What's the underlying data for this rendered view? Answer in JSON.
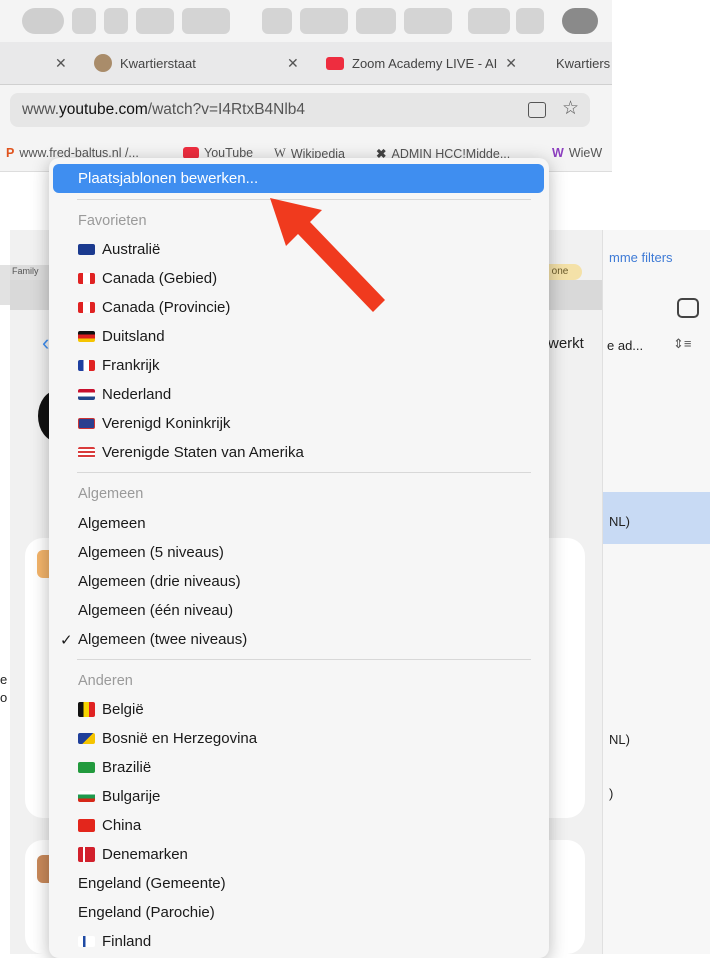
{
  "browser": {
    "tabs": [
      {
        "title": "Kwartierstaat"
      },
      {
        "title": "Zoom Academy LIVE - AI"
      },
      {
        "title": "Kwartiers"
      }
    ],
    "url_prefix": "www.",
    "url_domain": "youtube.com",
    "url_path": "/watch?v=I4RtxB4Nlb4",
    "bookmarks": [
      "www.fred-baltus.nl /...",
      "YouTube",
      "Wikipedia",
      "ADMIN HCC!Midde...",
      "WieW"
    ]
  },
  "background": {
    "right_labels": [
      "mme filters",
      "e ad...",
      "werkt",
      "NL)",
      "NL)",
      ")",
      "Family",
      "one",
      "e",
      "o"
    ]
  },
  "menu": {
    "edit_label": "Plaatsjablonen bewerken...",
    "favorites_header": "Favorieten",
    "favorites": [
      {
        "label": "Australië",
        "flag": "australia"
      },
      {
        "label": "Canada (Gebied)",
        "flag": "canada"
      },
      {
        "label": "Canada (Provincie)",
        "flag": "canada"
      },
      {
        "label": "Duitsland",
        "flag": "germany"
      },
      {
        "label": "Frankrijk",
        "flag": "france"
      },
      {
        "label": "Nederland",
        "flag": "netherlands"
      },
      {
        "label": "Verenigd Koninkrijk",
        "flag": "uk"
      },
      {
        "label": "Verenigde Staten van Amerika",
        "flag": "usa"
      }
    ],
    "general_header": "Algemeen",
    "general": [
      {
        "label": "Algemeen",
        "checked": false
      },
      {
        "label": "Algemeen (5 niveaus)",
        "checked": false
      },
      {
        "label": "Algemeen (drie niveaus)",
        "checked": false
      },
      {
        "label": "Algemeen (één niveau)",
        "checked": false
      },
      {
        "label": "Algemeen (twee niveaus)",
        "checked": true
      }
    ],
    "other_header": "Anderen",
    "other": [
      {
        "label": "België",
        "flag": "belgium"
      },
      {
        "label": "Bosnië en Herzegovina",
        "flag": "bosnia"
      },
      {
        "label": "Brazilië",
        "flag": "brazil"
      },
      {
        "label": "Bulgarije",
        "flag": "bulgaria"
      },
      {
        "label": "China",
        "flag": "china"
      },
      {
        "label": "Denemarken",
        "flag": "denmark"
      },
      {
        "label": "Engeland (Gemeente)",
        "flag": ""
      },
      {
        "label": "Engeland (Parochie)",
        "flag": ""
      },
      {
        "label": "Finland",
        "flag": "finland"
      }
    ]
  },
  "colors": {
    "highlight": "#3f8ef0",
    "arrow": "#f03a1e"
  }
}
